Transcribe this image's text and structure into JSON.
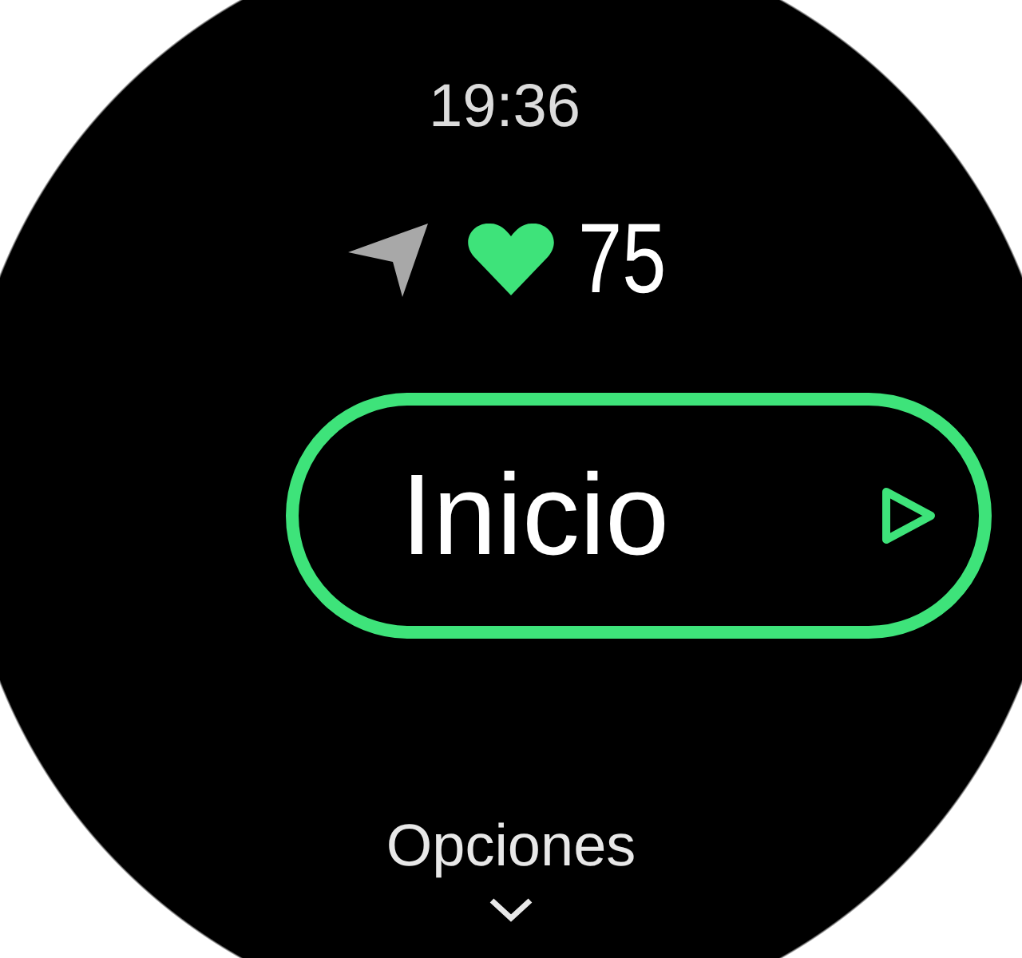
{
  "time": "19:36",
  "heart_rate": "75",
  "start_button": {
    "label": "Inicio"
  },
  "options": {
    "label": "Opciones"
  }
}
